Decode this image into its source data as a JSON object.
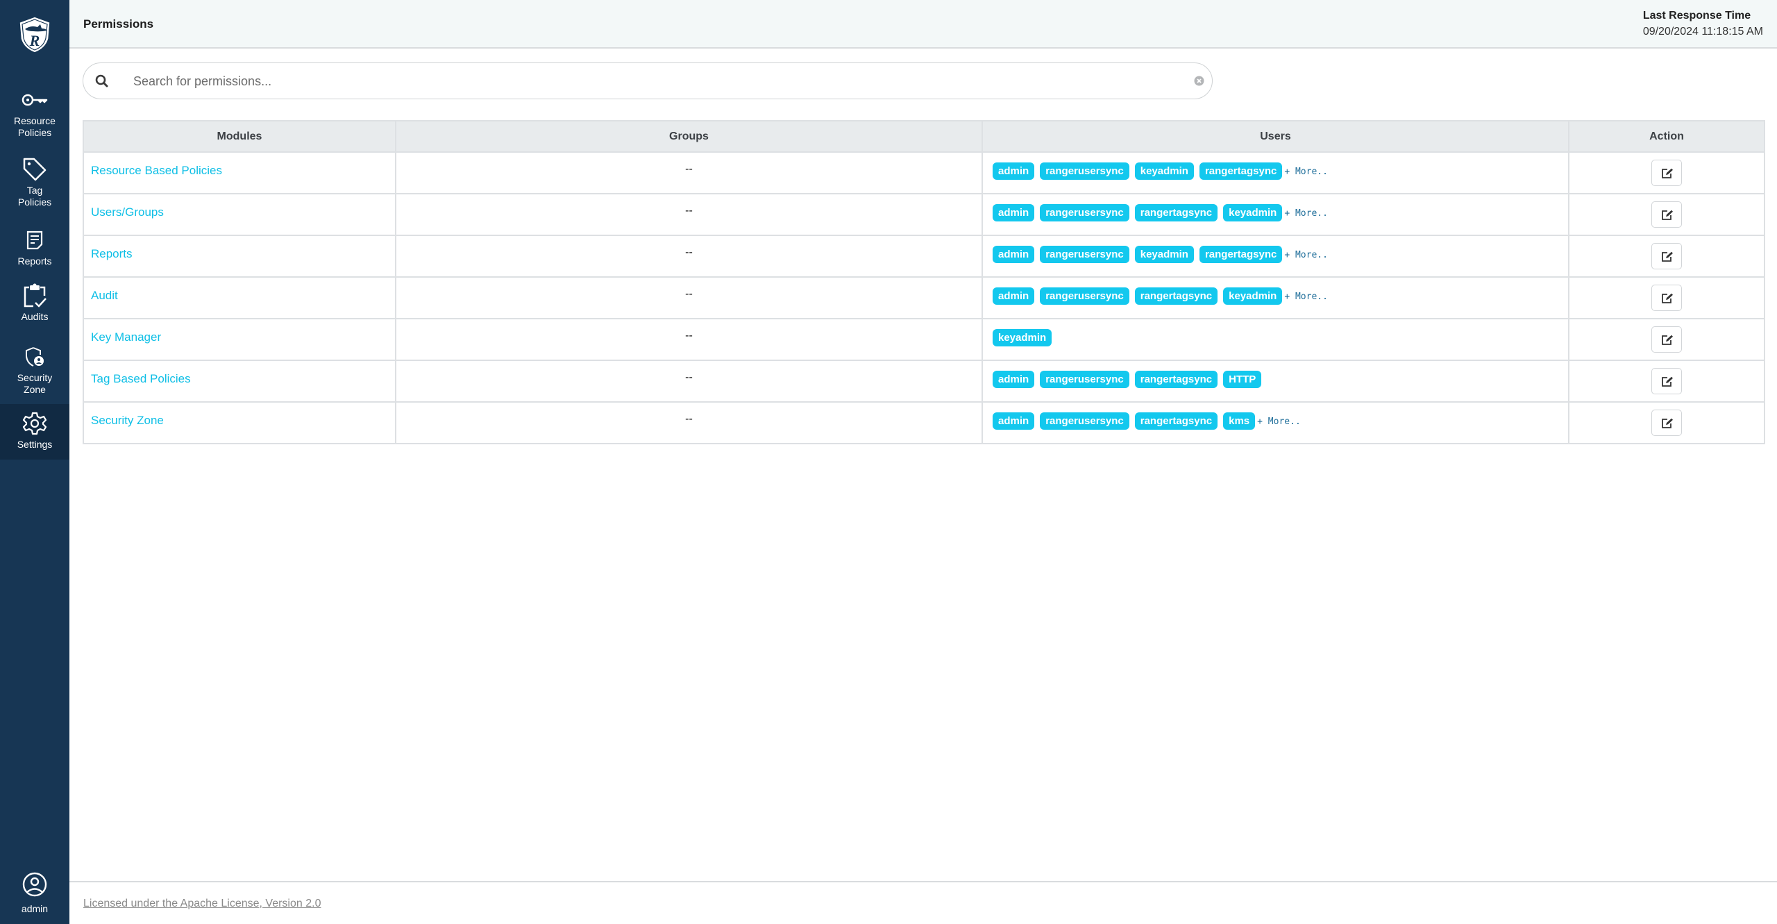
{
  "sidebar": {
    "logo": "ranger-logo",
    "items": [
      {
        "label": "Resource\nPolicies",
        "line1": "Resource",
        "line2": "Policies",
        "icon": "key-icon"
      },
      {
        "label": "Tag Policies",
        "line1": "Tag",
        "line2": "Policies",
        "icon": "tag-icon"
      },
      {
        "label": "Reports",
        "line1": "Reports",
        "line2": "",
        "icon": "report-icon"
      },
      {
        "label": "Audits",
        "line1": "Audits",
        "line2": "",
        "icon": "clipboard-check-icon"
      },
      {
        "label": "Security Zone",
        "line1": "Security",
        "line2": "Zone",
        "icon": "shield-user-icon"
      },
      {
        "label": "Settings",
        "line1": "Settings",
        "line2": "",
        "icon": "gear-icon",
        "active": true
      }
    ],
    "user": {
      "label": "admin",
      "icon": "user-circle-icon"
    }
  },
  "header": {
    "title": "Permissions",
    "last_response_label": "Last Response Time",
    "last_response_value": "09/20/2024 11:18:15 AM"
  },
  "search": {
    "placeholder": "Search for permissions...",
    "value": ""
  },
  "table": {
    "columns": [
      "Modules",
      "Groups",
      "Users",
      "Action"
    ],
    "more_label": "+ More..",
    "rows": [
      {
        "module": "Resource Based Policies",
        "groups": "--",
        "users": [
          "admin",
          "rangerusersync",
          "keyadmin",
          "rangertagsync"
        ],
        "more": true
      },
      {
        "module": "Users/Groups",
        "groups": "--",
        "users": [
          "admin",
          "rangerusersync",
          "rangertagsync",
          "keyadmin"
        ],
        "more": true
      },
      {
        "module": "Reports",
        "groups": "--",
        "users": [
          "admin",
          "rangerusersync",
          "keyadmin",
          "rangertagsync"
        ],
        "more": true
      },
      {
        "module": "Audit",
        "groups": "--",
        "users": [
          "admin",
          "rangerusersync",
          "rangertagsync",
          "keyadmin"
        ],
        "more": true
      },
      {
        "module": "Key Manager",
        "groups": "--",
        "users": [
          "keyadmin"
        ],
        "more": false
      },
      {
        "module": "Tag Based Policies",
        "groups": "--",
        "users": [
          "admin",
          "rangerusersync",
          "rangertagsync",
          "HTTP"
        ],
        "more": false
      },
      {
        "module": "Security Zone",
        "groups": "--",
        "users": [
          "admin",
          "rangerusersync",
          "rangertagsync",
          "kms"
        ],
        "more": true
      }
    ]
  },
  "footer": {
    "license_link": "Licensed under the Apache License, Version 2.0"
  },
  "colors": {
    "sidebar_bg": "#173654",
    "sidebar_active": "#112a43",
    "badge": "#13c8ee",
    "link": "#0fbfe6",
    "header_bg": "#f3f8f8"
  }
}
